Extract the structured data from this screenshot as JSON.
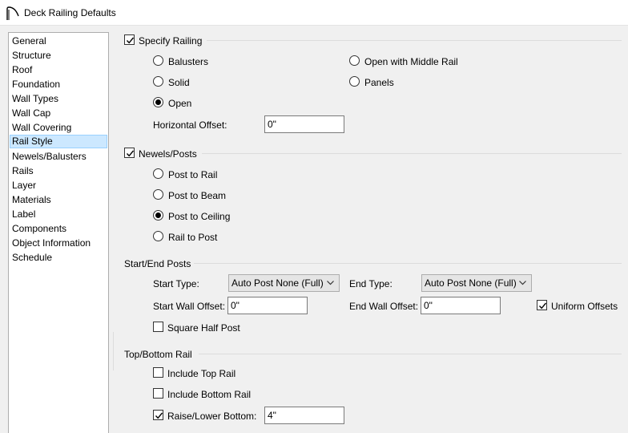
{
  "window": {
    "title": "Deck Railing Defaults"
  },
  "sidebar": {
    "items": [
      "General",
      "Structure",
      "Roof",
      "Foundation",
      "Wall Types",
      "Wall Cap",
      "Wall Covering",
      "Rail Style",
      "Newels/Balusters",
      "Rails",
      "Layer",
      "Materials",
      "Label",
      "Components",
      "Object Information",
      "Schedule"
    ],
    "selected": "Rail Style"
  },
  "specify_railing": {
    "label": "Specify Railing",
    "checked": true,
    "options": [
      "Balusters",
      "Solid",
      "Open",
      "Open with Middle Rail",
      "Panels"
    ],
    "selected": "Open",
    "horizontal_offset_label": "Horizontal Offset:",
    "horizontal_offset_value": "0\""
  },
  "newels_posts": {
    "label": "Newels/Posts",
    "checked": true,
    "options": [
      "Post to Rail",
      "Post to Beam",
      "Post to Ceiling",
      "Rail to Post"
    ],
    "selected": "Post to Ceiling"
  },
  "start_end_posts": {
    "heading": "Start/End Posts",
    "start_type_label": "Start Type:",
    "start_type_value": "Auto Post None (Full)",
    "end_type_label": "End Type:",
    "end_type_value": "Auto Post None (Full)",
    "start_wall_offset_label": "Start Wall Offset:",
    "start_wall_offset_value": "0\"",
    "end_wall_offset_label": "End Wall Offset:",
    "end_wall_offset_value": "0\"",
    "uniform_offsets_label": "Uniform Offsets",
    "uniform_offsets_checked": true,
    "square_half_post_label": "Square Half Post",
    "square_half_post_checked": false
  },
  "top_bottom_rail": {
    "heading": "Top/Bottom Rail",
    "include_top_rail_label": "Include Top Rail",
    "include_top_rail_checked": false,
    "include_bottom_rail_label": "Include Bottom Rail",
    "include_bottom_rail_checked": false,
    "raise_lower_bottom_label": "Raise/Lower Bottom:",
    "raise_lower_bottom_checked": true,
    "raise_lower_bottom_value": "4\""
  },
  "colors": {
    "selection_bg": "#cce8ff",
    "selection_border": "#99d1ff",
    "dialog_bg": "#f0f0f0"
  }
}
